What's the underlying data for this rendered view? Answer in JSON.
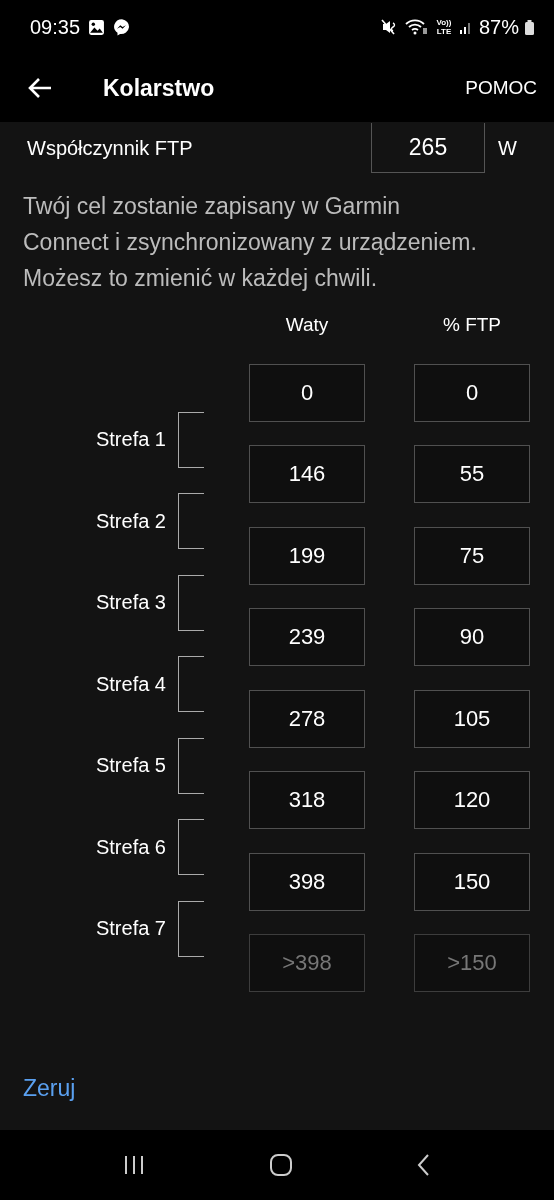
{
  "status_bar": {
    "time": "09:35",
    "battery": "87%",
    "volte": "Vo))",
    "network": "LTE"
  },
  "app_bar": {
    "title": "Kolarstwo",
    "action": "POMOC"
  },
  "ftp": {
    "label": "Współczynnik FTP",
    "value": "265",
    "unit": "W"
  },
  "info": "Twój cel zostanie zapisany w Garmin Connect i zsynchronizowany z urządzeniem. Możesz to zmienić w każdej chwili.",
  "columns": [
    "Waty",
    "% FTP"
  ],
  "zones": [
    "Strefa 1",
    "Strefa 2",
    "Strefa 3",
    "Strefa 4",
    "Strefa 5",
    "Strefa 6",
    "Strefa 7"
  ],
  "boundaries": [
    {
      "watts": "0",
      "ftp": "0",
      "disabled": false
    },
    {
      "watts": "146",
      "ftp": "55",
      "disabled": false
    },
    {
      "watts": "199",
      "ftp": "75",
      "disabled": false
    },
    {
      "watts": "239",
      "ftp": "90",
      "disabled": false
    },
    {
      "watts": "278",
      "ftp": "105",
      "disabled": false
    },
    {
      "watts": "318",
      "ftp": "120",
      "disabled": false
    },
    {
      "watts": "398",
      "ftp": "150",
      "disabled": false
    },
    {
      "watts": ">398",
      "ftp": ">150",
      "disabled": true
    }
  ],
  "reset": "Zeruj"
}
